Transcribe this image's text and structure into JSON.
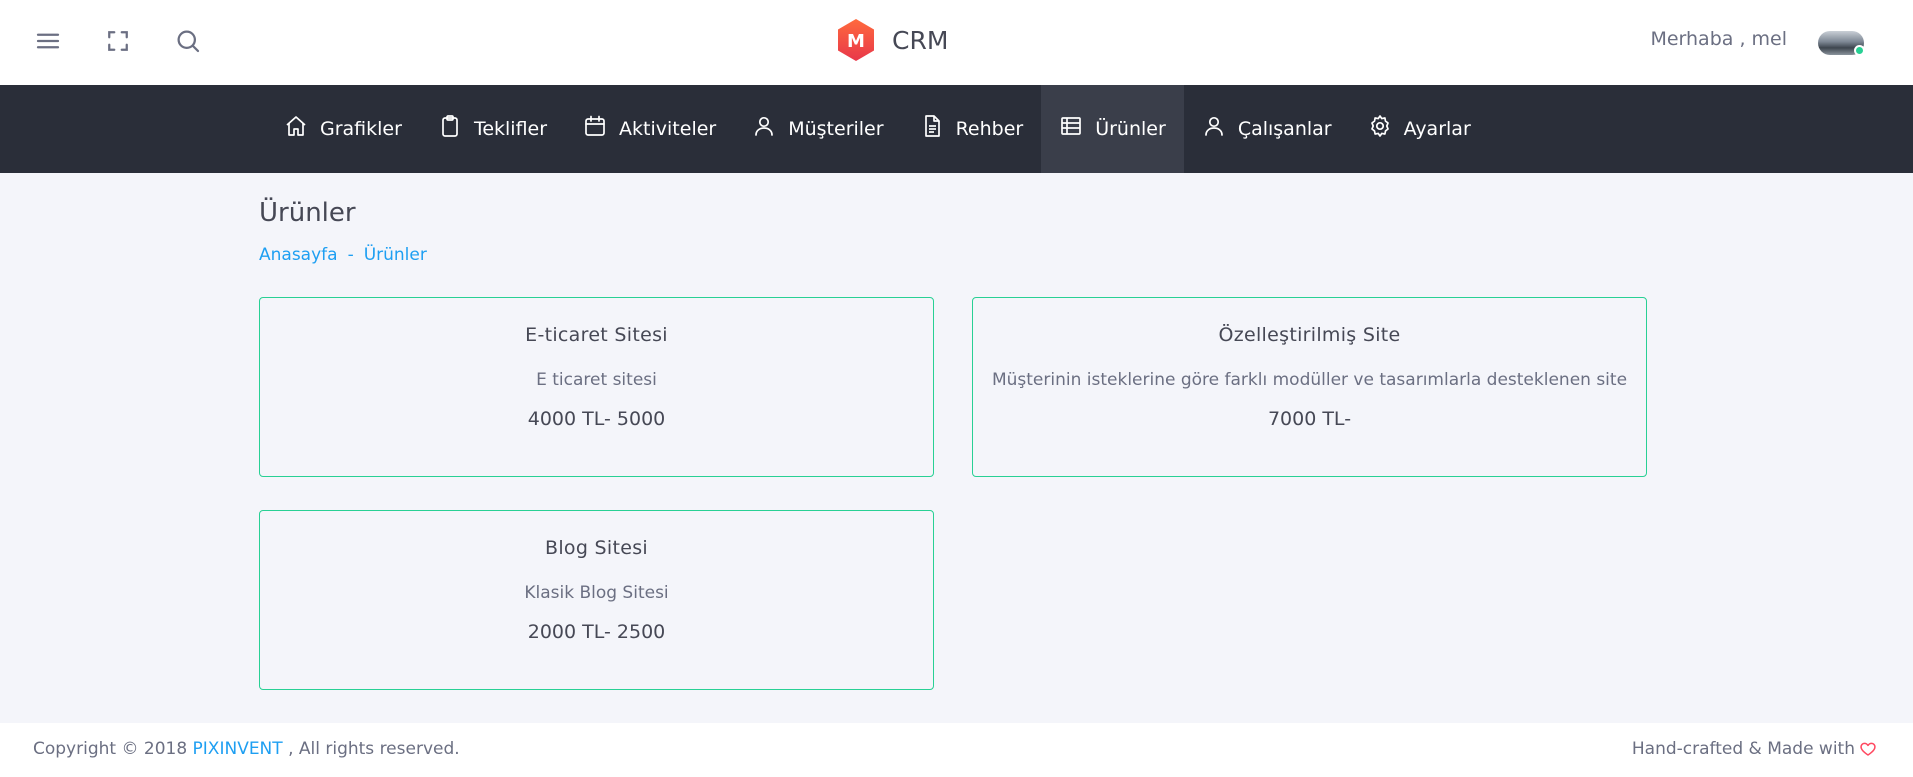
{
  "header": {
    "brand_letter": "M",
    "brand_name": "CRM",
    "greeting": "Merhaba , mel",
    "icons": [
      "menu-icon",
      "fullscreen-icon",
      "search-icon"
    ]
  },
  "nav": {
    "items": [
      {
        "label": "Grafikler",
        "icon": "home-icon",
        "active": false
      },
      {
        "label": "Teklifler",
        "icon": "clipboard-icon",
        "active": false
      },
      {
        "label": "Aktiviteler",
        "icon": "calendar-icon",
        "active": false
      },
      {
        "label": "Müşteriler",
        "icon": "user-icon",
        "active": false
      },
      {
        "label": "Rehber",
        "icon": "document-icon",
        "active": false
      },
      {
        "label": "Ürünler",
        "icon": "table-list-icon",
        "active": true
      },
      {
        "label": "Çalışanlar",
        "icon": "user-icon",
        "active": false
      },
      {
        "label": "Ayarlar",
        "icon": "gear-icon",
        "active": false
      }
    ]
  },
  "page": {
    "title": "Ürünler",
    "breadcrumb": [
      "Anasayfa",
      "-",
      "Ürünler"
    ]
  },
  "products": [
    {
      "title": "E-ticaret Sitesi",
      "description": "E ticaret sitesi",
      "price": "4000 TL- 5000"
    },
    {
      "title": "Özelleştirilmiş Site",
      "description": "Müşterinin isteklerine göre farklı modüller ve tasarımlarla desteklenen site",
      "price": "7000 TL-"
    },
    {
      "title": "Blog Sitesi",
      "description": "Klasik Blog Sitesi",
      "price": "2000 TL- 2500"
    }
  ],
  "footer": {
    "copyright_prefix": "Copyright © 2018 ",
    "company": "PIXINVENT",
    "copyright_suffix": " , All rights reserved.",
    "made_with": "Hand-crafted & Made with"
  },
  "colors": {
    "nav_bg": "#2a2e39",
    "nav_active_bg": "#3a3e4a",
    "card_border": "#28d094",
    "link": "#1e9ff2",
    "brand": "#f2543c",
    "heart": "#ff4961"
  }
}
